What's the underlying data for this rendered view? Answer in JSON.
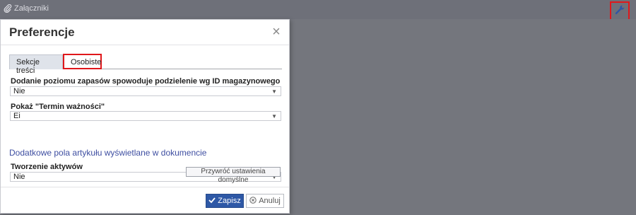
{
  "topbar": {
    "title": "Załączniki",
    "title_icon": "paperclip-icon",
    "settings_icon": "wrench-icon"
  },
  "dialog": {
    "title": "Preferencje",
    "close_icon": "close-icon",
    "tabs": [
      {
        "label": "Sekcje treści",
        "active": false
      },
      {
        "label": "Osobiste",
        "active": true
      }
    ],
    "fields": [
      {
        "label": "Dodanie poziomu zapasów spowoduje podzielenie wg ID magazynowego",
        "value": "Nie"
      },
      {
        "label": "Pokaż \"Termin ważności\"",
        "value": "Ei"
      },
      {
        "label": "Tworzenie aktywów",
        "value": "Nie"
      }
    ],
    "link_text": "Dodatkowe pola artykułu wyświetlane w dokumencie",
    "reset_label": "Przywróć ustawienia domyślne",
    "save_label": "Zapisz",
    "cancel_label": "Anuluj"
  },
  "colors": {
    "highlight": "#e0171b",
    "primary": "#2e58a6",
    "link": "#3e4ea1"
  }
}
